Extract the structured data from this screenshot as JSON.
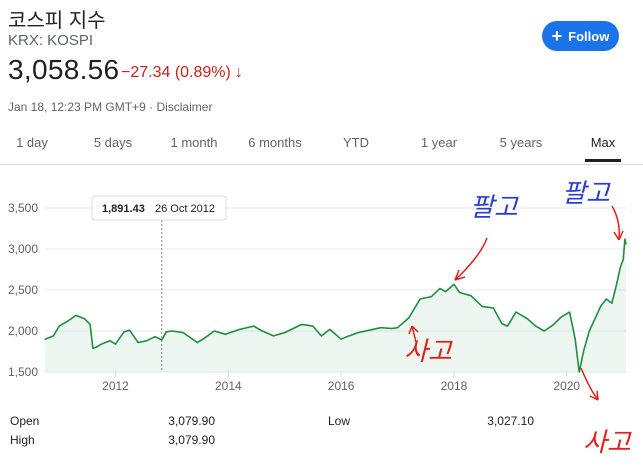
{
  "header": {
    "title": "코스피 지수",
    "exchange": "KRX: KOSPI",
    "price": "3,058.56",
    "change": "−27.34 (0.89%)",
    "change_arrow": "↓",
    "timestamp": "Jan 18, 12:23 PM GMT+9",
    "separator": "·",
    "disclaimer": "Disclaimer",
    "follow_label": "Follow",
    "follow_icon": "+"
  },
  "tabs": [
    {
      "label": "1 day",
      "active": false
    },
    {
      "label": "5 days",
      "active": false
    },
    {
      "label": "1 month",
      "active": false
    },
    {
      "label": "6 months",
      "active": false
    },
    {
      "label": "YTD",
      "active": false
    },
    {
      "label": "1 year",
      "active": false
    },
    {
      "label": "5 years",
      "active": false
    },
    {
      "label": "Max",
      "active": true
    }
  ],
  "colors": {
    "accent": "#1a73e8",
    "negative": "#c5221f",
    "line": "#1e8e3e",
    "annotation_blue": "#2a3fd0",
    "annotation_red": "#e0201b"
  },
  "tooltip": {
    "value": "1,891.43",
    "date": "26 Oct 2012"
  },
  "annotations": {
    "sell": "팔고",
    "buy": "사고"
  },
  "stats": {
    "open_label": "Open",
    "open_value": "3,079.90",
    "high_label": "High",
    "high_value": "3,079.90",
    "low_label": "Low",
    "low_value": "3,027.10"
  },
  "chart_data": {
    "type": "line",
    "title": "",
    "xlabel": "",
    "ylabel": "",
    "x_ticks": [
      "2012",
      "2014",
      "2016",
      "2018",
      "2020"
    ],
    "y_ticks": [
      "1,500",
      "2,000",
      "2,500",
      "3,000",
      "3,500"
    ],
    "ylim": [
      1500,
      3500
    ],
    "xlim": [
      2010.75,
      2021.05
    ],
    "grid": true,
    "series": [
      {
        "x": [
          2010.75,
          2010.9,
          2011.0,
          2011.15,
          2011.3,
          2011.45,
          2011.55,
          2011.6,
          2011.65,
          2011.75,
          2011.9,
          2012.0,
          2012.15,
          2012.25,
          2012.4,
          2012.55,
          2012.7,
          2012.82,
          2012.9,
          2013.0,
          2013.2,
          2013.45,
          2013.55,
          2013.75,
          2013.95,
          2014.2,
          2014.45,
          2014.6,
          2014.8,
          2015.0,
          2015.3,
          2015.5,
          2015.65,
          2015.8,
          2016.0,
          2016.1,
          2016.3,
          2016.5,
          2016.7,
          2016.9,
          2017.0,
          2017.2,
          2017.4,
          2017.6,
          2017.75,
          2017.85,
          2018.0,
          2018.1,
          2018.3,
          2018.5,
          2018.7,
          2018.85,
          2018.95,
          2019.1,
          2019.3,
          2019.45,
          2019.6,
          2019.75,
          2019.9,
          2020.05,
          2020.15,
          2020.22,
          2020.3,
          2020.4,
          2020.5,
          2020.6,
          2020.7,
          2020.8,
          2020.88,
          2020.95,
          2021.0,
          2021.03,
          2021.05
        ],
        "y": [
          1900,
          1940,
          2060,
          2120,
          2190,
          2150,
          2080,
          1790,
          1800,
          1840,
          1880,
          1840,
          1990,
          2010,
          1860,
          1880,
          1930,
          1891,
          1990,
          2000,
          1980,
          1860,
          1900,
          2000,
          1960,
          2020,
          2060,
          2000,
          1940,
          1980,
          2080,
          2060,
          1940,
          2020,
          1900,
          1930,
          1980,
          2010,
          2040,
          2030,
          2040,
          2160,
          2390,
          2420,
          2520,
          2480,
          2570,
          2470,
          2430,
          2300,
          2280,
          2090,
          2060,
          2230,
          2150,
          2060,
          2000,
          2070,
          2170,
          2230,
          1900,
          1500,
          1760,
          2000,
          2150,
          2300,
          2390,
          2340,
          2560,
          2780,
          2870,
          3120,
          3060
        ]
      }
    ]
  }
}
